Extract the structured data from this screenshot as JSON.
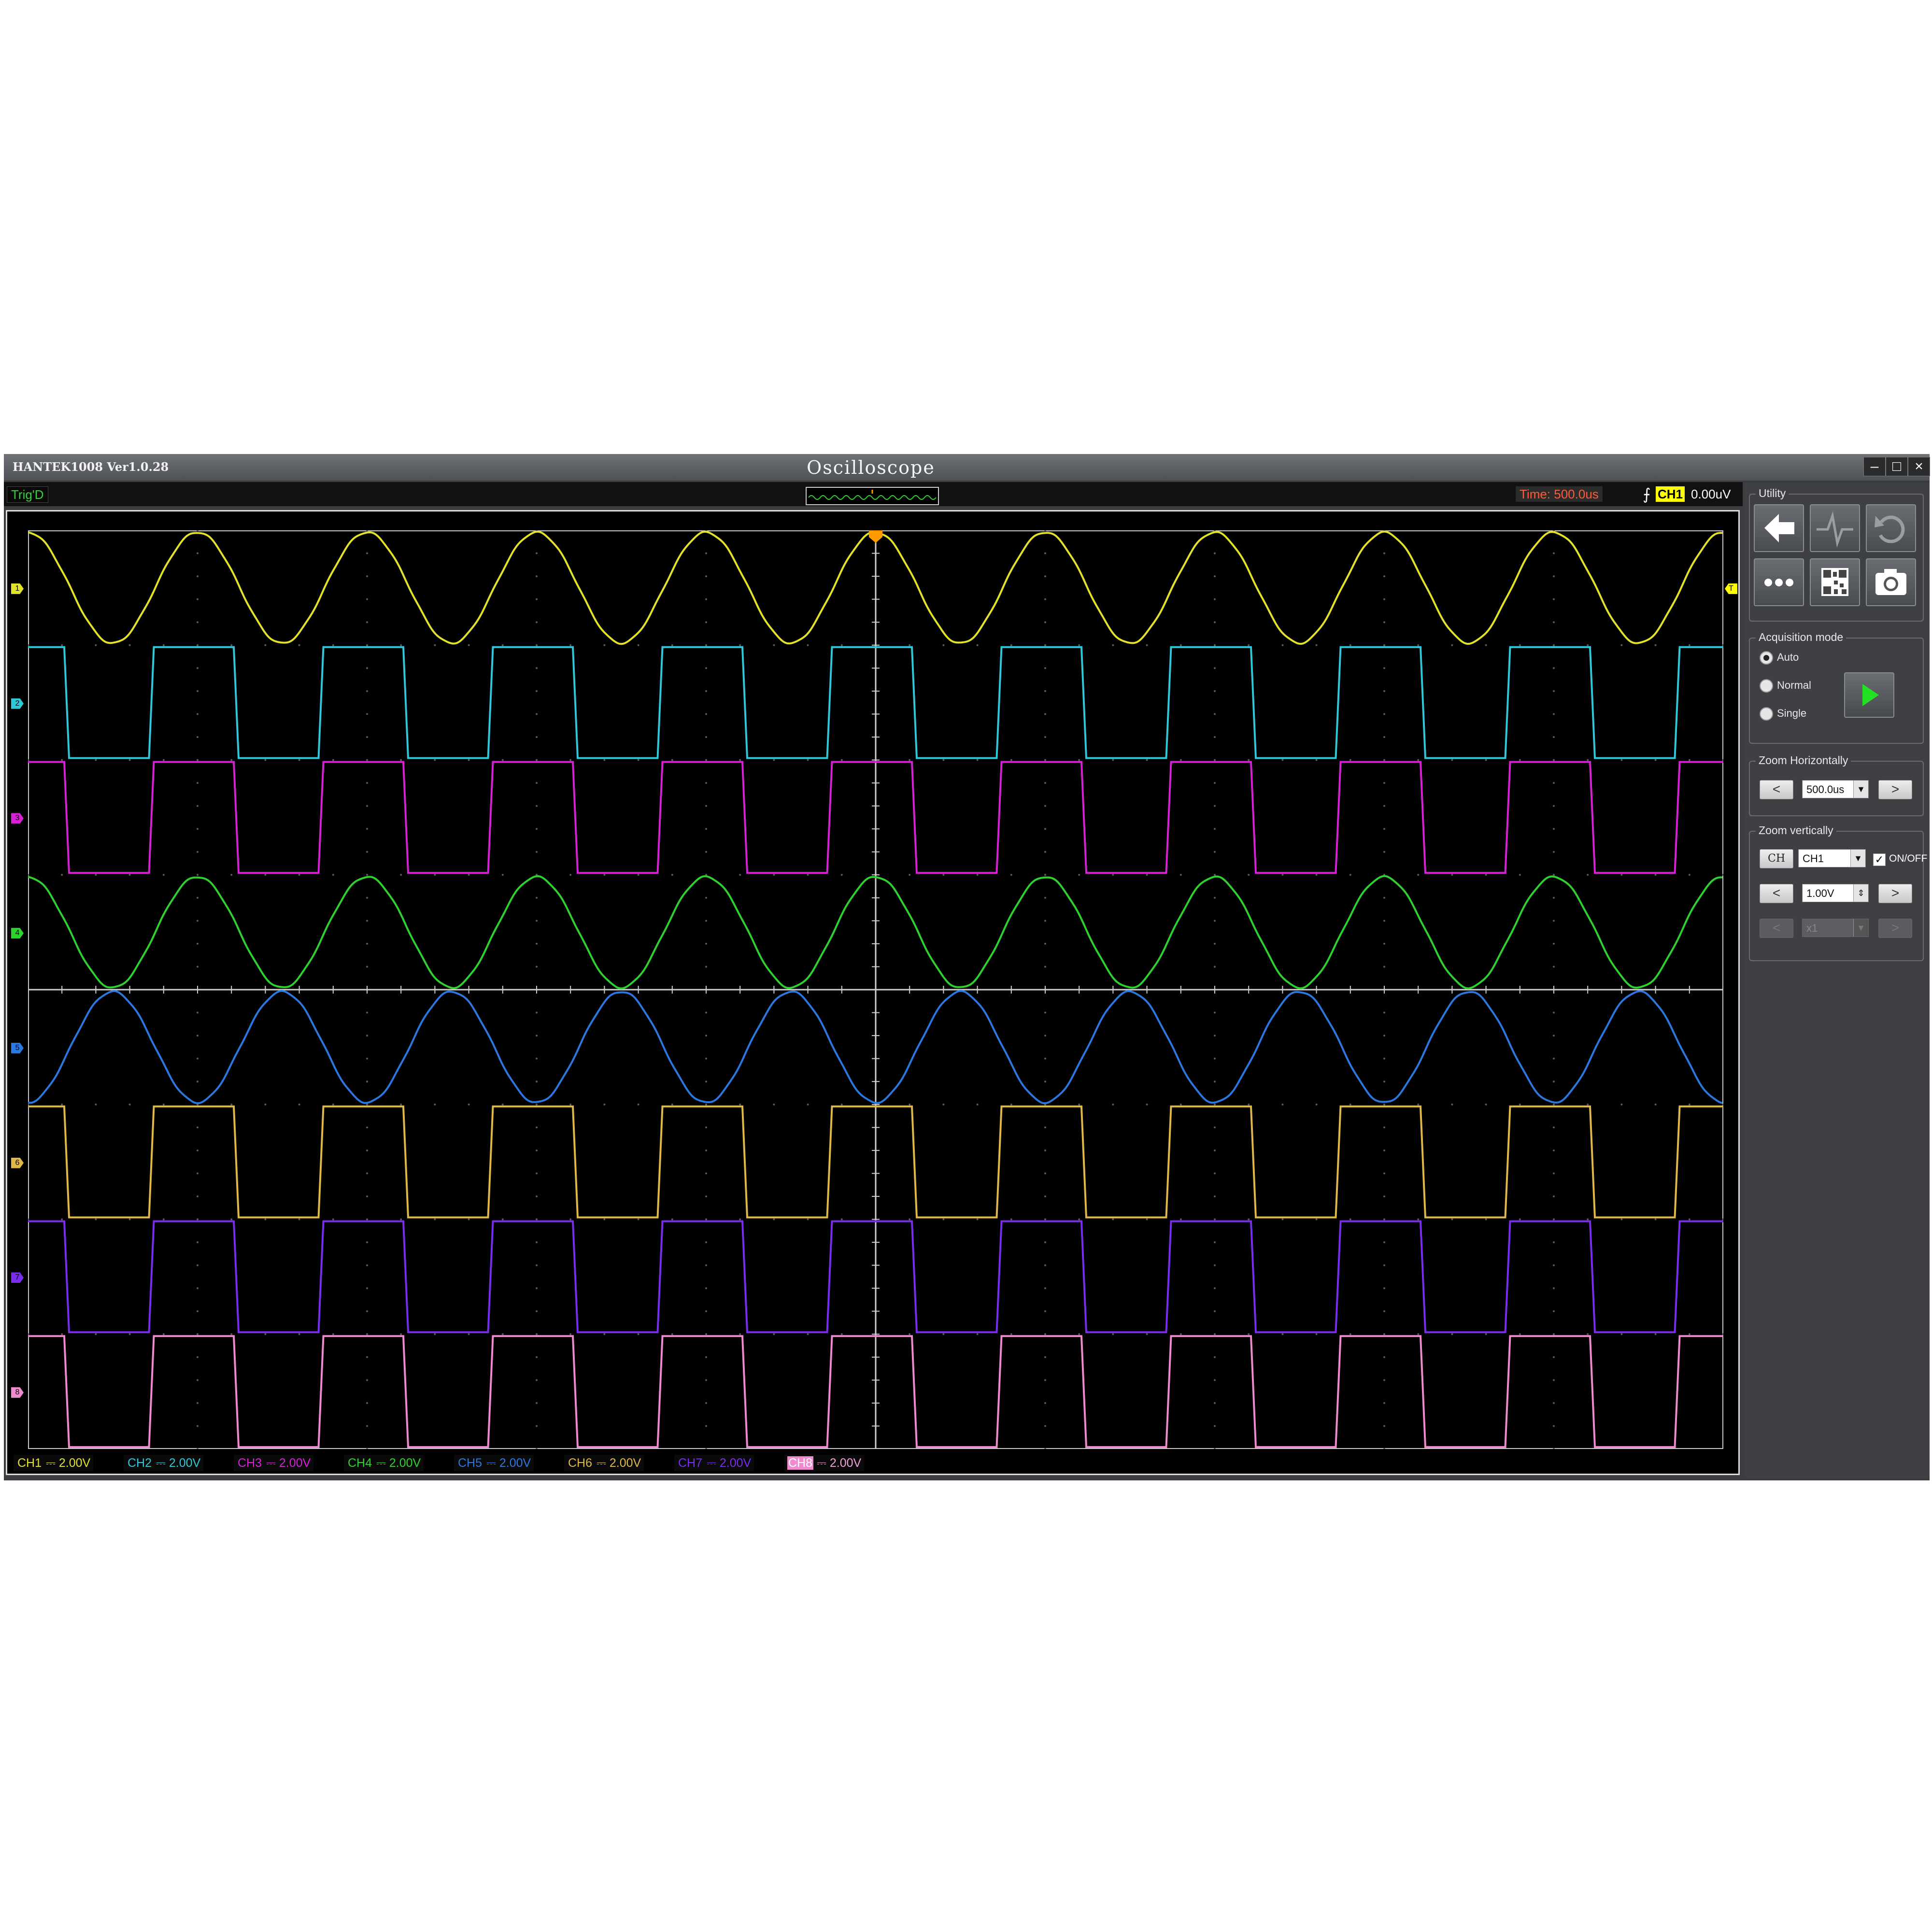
{
  "window": {
    "app_name": "HANTEK1008 Ver1.0.28",
    "title": "Oscilloscope",
    "minimize": "–",
    "maximize": "□",
    "close": "×"
  },
  "status": {
    "trig_status": "Trig'D",
    "time": "Time: 500.0us",
    "trig_slope": "⨍",
    "trig_channel": "CH1",
    "trig_level": "0.00uV"
  },
  "channels": [
    {
      "label": "CH1",
      "coupling": "⎓",
      "scale": "2.00V",
      "color": "#e2e22a",
      "marker": "1",
      "wave": "sine",
      "phase": 0.0,
      "highlight": false
    },
    {
      "label": "CH2",
      "coupling": "⎓",
      "scale": "2.00V",
      "color": "#2ec8d8",
      "marker": "2",
      "wave": "square",
      "phase": 0.0,
      "highlight": false
    },
    {
      "label": "CH3",
      "coupling": "⎓",
      "scale": "2.00V",
      "color": "#d820d8",
      "marker": "3",
      "wave": "square",
      "phase": 0.0,
      "highlight": false
    },
    {
      "label": "CH4",
      "coupling": "⎓",
      "scale": "2.00V",
      "color": "#2ed22e",
      "marker": "4",
      "wave": "sine",
      "phase": 0.0,
      "highlight": false
    },
    {
      "label": "CH5",
      "coupling": "⎓",
      "scale": "2.00V",
      "color": "#2a78e0",
      "marker": "5",
      "wave": "sine",
      "phase": 0.5,
      "highlight": false
    },
    {
      "label": "CH6",
      "coupling": "⎓",
      "scale": "2.00V",
      "color": "#e0b848",
      "marker": "6",
      "wave": "square",
      "phase": 0.0,
      "highlight": false
    },
    {
      "label": "CH7",
      "coupling": "⎓",
      "scale": "2.00V",
      "color": "#7a2cf0",
      "marker": "7",
      "wave": "square",
      "phase": 0.0,
      "highlight": false
    },
    {
      "label": "CH8",
      "coupling": "⎓",
      "scale": "2.00V",
      "color": "#f08ad0",
      "marker": "8",
      "wave": "square",
      "phase": 0.0,
      "highlight": true
    }
  ],
  "utility": {
    "title": "Utility",
    "tools": [
      "back-arrow-icon",
      "waveform-icon",
      "undo-icon",
      "more-icon",
      "qr-code-icon",
      "camera-icon"
    ]
  },
  "acquisition": {
    "title": "Acquisition mode",
    "modes": [
      "Auto",
      "Normal",
      "Single"
    ],
    "selected": "Auto"
  },
  "zoom_h": {
    "title": "Zoom Horizontally",
    "prev": "<",
    "next": ">",
    "value": "500.0us"
  },
  "zoom_v": {
    "title": "Zoom vertically",
    "ch_button": "CH",
    "channel": "CH1",
    "onoff_label": "ON/OFF",
    "onoff_checked": "✓",
    "prev": "<",
    "next": ">",
    "volts": "1.00V",
    "probe": "x1"
  }
}
